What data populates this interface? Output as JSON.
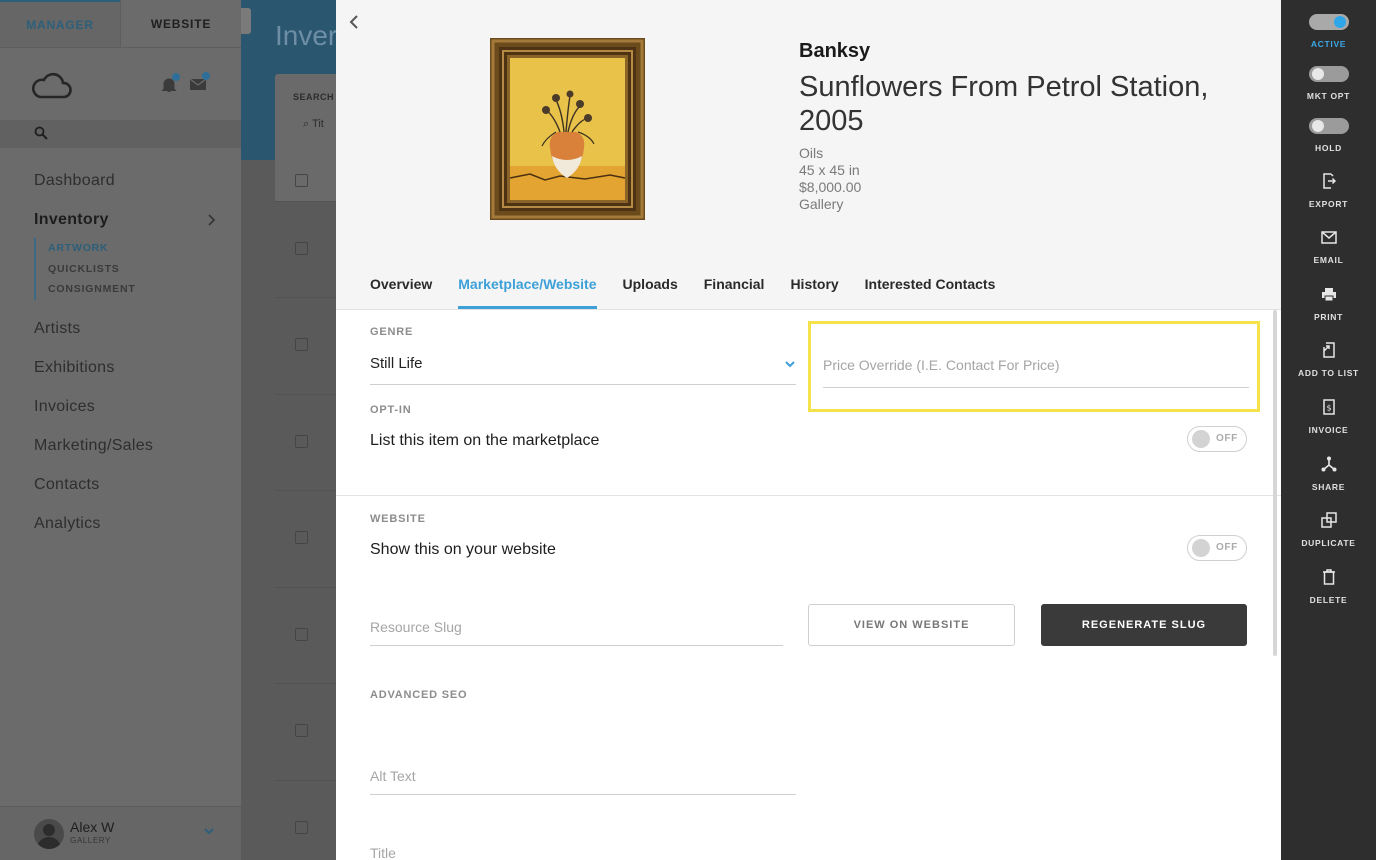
{
  "sidebar": {
    "tabs": [
      {
        "label": "MANAGER"
      },
      {
        "label": "WEBSITE"
      }
    ],
    "nav": [
      {
        "label": "Dashboard"
      },
      {
        "label": "Inventory"
      },
      {
        "label": "Artists"
      },
      {
        "label": "Exhibitions"
      },
      {
        "label": "Invoices"
      },
      {
        "label": "Marketing/Sales"
      },
      {
        "label": "Contacts"
      },
      {
        "label": "Analytics"
      }
    ],
    "inventory_sub": [
      {
        "label": "ARTWORK"
      },
      {
        "label": "QUICKLISTS"
      },
      {
        "label": "CONSIGNMENT"
      }
    ],
    "user": {
      "name": "Alex W",
      "role": "GALLERY"
    }
  },
  "background": {
    "title": "Inver",
    "search_label": "SEARCH I",
    "search_placeholder": "Tit"
  },
  "artwork": {
    "artist": "Banksy",
    "title": "Sunflowers From Petrol Station, 2005",
    "medium": "Oils",
    "dimensions": "45 x 45 in",
    "price": "$8,000.00",
    "location": "Gallery"
  },
  "tabs": [
    {
      "label": "Overview"
    },
    {
      "label": "Marketplace/Website"
    },
    {
      "label": "Uploads"
    },
    {
      "label": "Financial"
    },
    {
      "label": "History"
    },
    {
      "label": "Interested Contacts"
    }
  ],
  "marketplace": {
    "genre_label": "GENRE",
    "genre_value": "Still Life",
    "price_override_placeholder": "Price Override (I.E. Contact For Price)",
    "optin_label": "OPT-IN",
    "optin_text": "List this item on the marketplace",
    "optin_state": "OFF"
  },
  "website": {
    "label": "WEBSITE",
    "show_text": "Show this on your website",
    "show_state": "OFF",
    "slug_placeholder": "Resource Slug",
    "view_button": "VIEW ON WEBSITE",
    "regenerate_button": "REGENERATE SLUG"
  },
  "seo": {
    "label": "ADVANCED SEO",
    "alt_placeholder": "Alt Text",
    "title_placeholder": "Title"
  },
  "actions": [
    {
      "label": "ACTIVE",
      "icon": "toggle-on"
    },
    {
      "label": "MKT OPT",
      "icon": "toggle-off"
    },
    {
      "label": "HOLD",
      "icon": "toggle-off"
    },
    {
      "label": "EXPORT",
      "icon": "export-icon"
    },
    {
      "label": "EMAIL",
      "icon": "email-icon"
    },
    {
      "label": "PRINT",
      "icon": "print-icon"
    },
    {
      "label": "ADD TO LIST",
      "icon": "add-to-list-icon"
    },
    {
      "label": "INVOICE",
      "icon": "invoice-icon"
    },
    {
      "label": "SHARE",
      "icon": "share-icon"
    },
    {
      "label": "DUPLICATE",
      "icon": "duplicate-icon"
    },
    {
      "label": "DELETE",
      "icon": "delete-icon"
    }
  ],
  "colors": {
    "accent": "#3da0d8",
    "highlight": "#f4e24a",
    "dark_button": "#3a3a3a",
    "action_bar": "#2e2e2e"
  }
}
